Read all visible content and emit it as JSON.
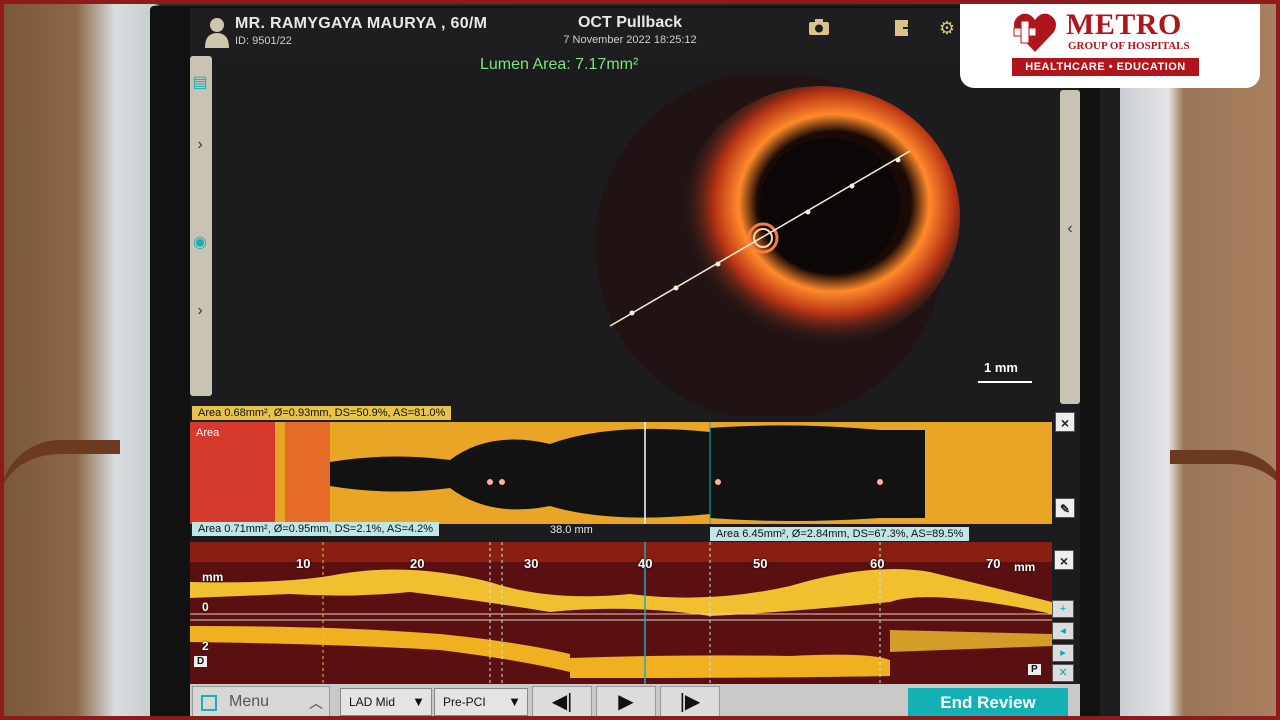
{
  "header": {
    "patient_name": "MR. RAMYGAYA MAURYA  , 60/M",
    "patient_id": "ID: 9501/22",
    "title": "OCT Pullback",
    "datetime": "7 November 2022 18:25:12",
    "icons": [
      "camera-icon",
      "export-icon",
      "gear-icon"
    ]
  },
  "image_view": {
    "lumen_area": "Lumen Area: 7.17mm²",
    "scale_bar": "1 mm"
  },
  "lumen_profile": {
    "label": "Area",
    "top_measure": "Area 0.68mm², Ø=0.93mm, DS=50.9%, AS=81.0%",
    "left_ref": "Area 0.71mm², Ø=0.95mm, DS=2.1%, AS=4.2%",
    "right_ref": "Area 6.45mm², Ø=2.84mm, DS=67.3%, AS=89.5%",
    "distance": "38.0 mm"
  },
  "longitudinal": {
    "axis_unit": "mm",
    "ticks": [
      "10",
      "20",
      "30",
      "40",
      "50",
      "60",
      "70"
    ],
    "depth_labels": [
      "0",
      "2"
    ],
    "left_marker": "D",
    "right_marker": "P"
  },
  "toolbar": {
    "menu_label": "Menu",
    "vessel_select": "LAD Mid",
    "phase_select": "Pre-PCI",
    "end_review": "End Review"
  },
  "logo": {
    "name": "METRO",
    "subtitle": "GROUP OF HOSPITALS",
    "tagline": "HEALTHCARE • EDUCATION"
  },
  "colors": {
    "accent_teal": "#14b1b4",
    "lumen_green": "#7ee37e",
    "brand_red": "#b0151b",
    "profile_orange": "#e8a526"
  }
}
